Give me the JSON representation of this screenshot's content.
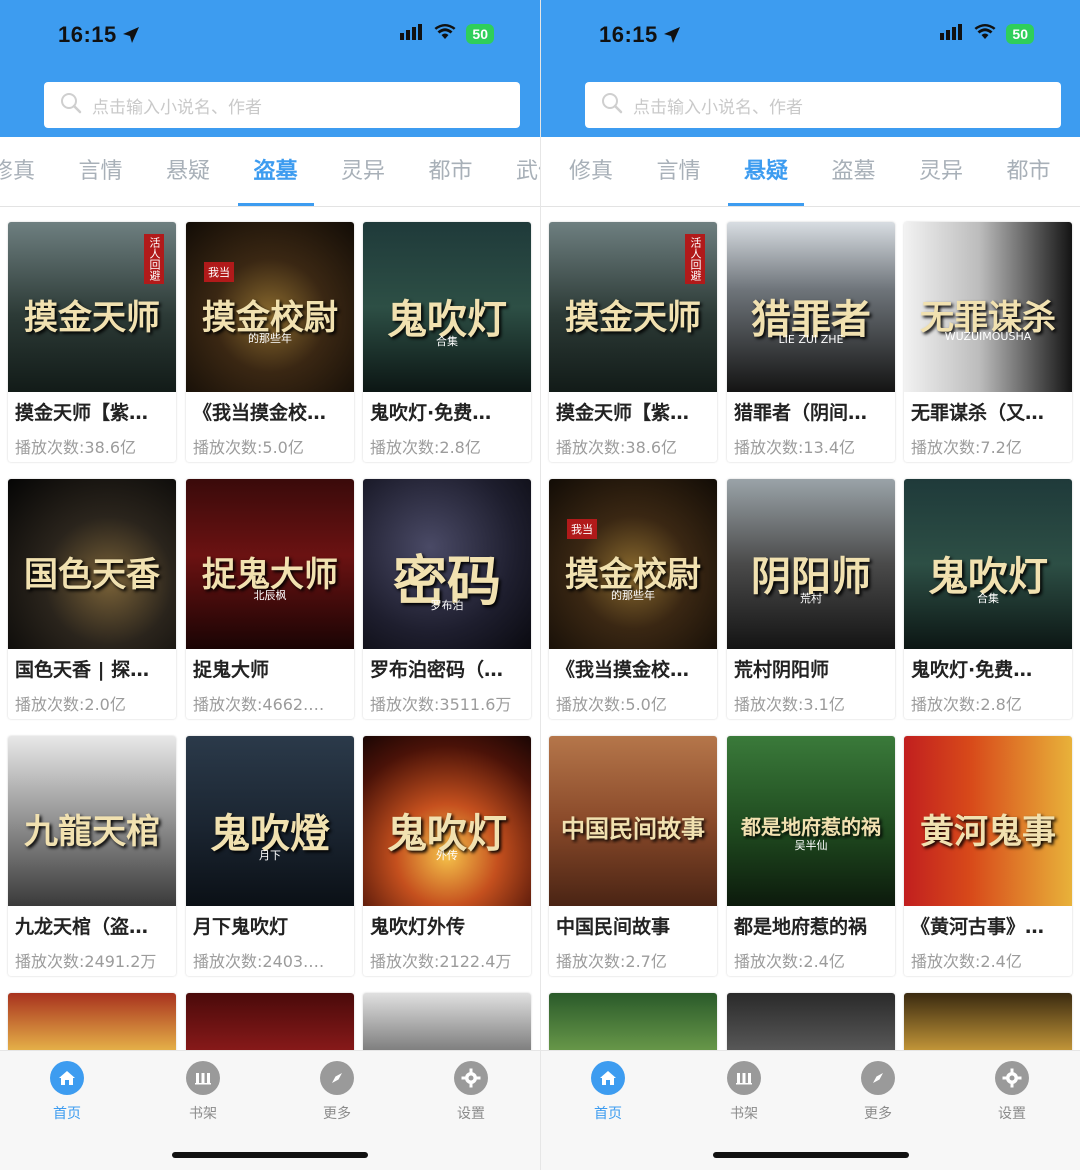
{
  "status": {
    "time": "16:15",
    "battery": "50"
  },
  "search": {
    "placeholder": "点击输入小说名、作者"
  },
  "left": {
    "tabs": [
      "修真",
      "言情",
      "悬疑",
      "盗墓",
      "灵异",
      "都市",
      "武侠"
    ],
    "active_tab": "盗墓",
    "books": [
      {
        "title": "摸金天师【紫…",
        "plays": "播放次数:38.6亿",
        "cover_text": "摸金天师",
        "cover_sub": "",
        "stamp": "活人回避",
        "bg": "linear-gradient(180deg,#6e7f80 0%,#2c3a36 55%,#121b18 100%)"
      },
      {
        "title": "《我当摸金校…",
        "plays": "播放次数:5.0亿",
        "cover_text": "摸金校尉",
        "cover_sub": "的那些年",
        "stamp": "我当",
        "bg": "radial-gradient(circle at 50% 55%,#8a6a2e 0%,#3a2713 45%,#120c06 100%)"
      },
      {
        "title": "鬼吹灯·免费…",
        "plays": "播放次数:2.8亿",
        "cover_text": "鬼吹灯",
        "cover_sub": "合集",
        "stamp": "",
        "bg": "linear-gradient(180deg,#1f3a3a 0%,#2d4f45 50%,#0c1614 100%)"
      },
      {
        "title": "国色天香 | 探…",
        "plays": "播放次数:2.0亿",
        "cover_text": "国色天香",
        "cover_sub": "",
        "stamp": "",
        "bg": "radial-gradient(circle at 60% 60%,#7a6238 0%,#2a241c 45%,#050505 100%)"
      },
      {
        "title": "捉鬼大师",
        "plays": "播放次数:4662.…",
        "cover_text": "捉鬼大师",
        "cover_sub": "北辰枫",
        "stamp": "",
        "bg": "linear-gradient(180deg,#3a0a0a 0%,#6b1212 45%,#1a0404 100%)"
      },
      {
        "title": "罗布泊密码（…",
        "plays": "播放次数:3511.6万",
        "cover_text": "密码",
        "cover_sub": "罗布泊",
        "stamp": "",
        "bg": "radial-gradient(circle at 40% 40%,#4a4a66 0%,#1e1e2e 60%,#0a0a10 100%)"
      },
      {
        "title": "九龙天棺（盗…",
        "plays": "播放次数:2491.2万",
        "cover_text": "九龍天棺",
        "cover_sub": "",
        "stamp": "",
        "bg": "linear-gradient(180deg,#e8e8e8 0%,#9a9a9a 45%,#3a3a3a 100%)"
      },
      {
        "title": "月下鬼吹灯",
        "plays": "播放次数:2403.…",
        "cover_text": "鬼吹燈",
        "cover_sub": "月下",
        "stamp": "",
        "bg": "linear-gradient(180deg,#2b3a4a 0%,#1a2430 55%,#0b1016 100%)"
      },
      {
        "title": "鬼吹灯外传",
        "plays": "播放次数:2122.4万",
        "cover_text": "鬼吹灯",
        "cover_sub": "外传",
        "stamp": "",
        "bg": "radial-gradient(circle at 50% 70%,#f5c24a 0%,#c5501e 35%,#4a1208 75%,#1a0604 100%)"
      }
    ]
  },
  "right": {
    "tabs": [
      "修真",
      "言情",
      "悬疑",
      "盗墓",
      "灵异",
      "都市"
    ],
    "active_tab": "悬疑",
    "books": [
      {
        "title": "摸金天师【紫…",
        "plays": "播放次数:38.6亿",
        "cover_text": "摸金天师",
        "cover_sub": "",
        "stamp": "活人回避",
        "bg": "linear-gradient(180deg,#6e7f80 0%,#2c3a36 55%,#121b18 100%)"
      },
      {
        "title": "猎罪者（阴间…",
        "plays": "播放次数:13.4亿",
        "cover_text": "猎罪者",
        "cover_sub": "LIE ZUI ZHE",
        "stamp": "",
        "bg": "linear-gradient(180deg,#d8dde2 0%,#6e747a 40%,#141414 100%)"
      },
      {
        "title": "无罪谋杀（又…",
        "plays": "播放次数:7.2亿",
        "cover_text": "无罪谋杀",
        "cover_sub": "WUZUIMOUSHA",
        "stamp": "",
        "bg": "linear-gradient(90deg,#f2f2f2 0%,#bcbcbc 45%,#141414 100%)"
      },
      {
        "title": "《我当摸金校…",
        "plays": "播放次数:5.0亿",
        "cover_text": "摸金校尉",
        "cover_sub": "的那些年",
        "stamp": "我当",
        "bg": "radial-gradient(circle at 50% 55%,#8a6a2e 0%,#3a2713 45%,#120c06 100%)"
      },
      {
        "title": "荒村阴阳师",
        "plays": "播放次数:3.1亿",
        "cover_text": "阴阳师",
        "cover_sub": "荒村",
        "stamp": "",
        "bg": "linear-gradient(180deg,#9aa3a8 0%,#4a4a4a 50%,#141414 100%)"
      },
      {
        "title": "鬼吹灯·免费…",
        "plays": "播放次数:2.8亿",
        "cover_text": "鬼吹灯",
        "cover_sub": "合集",
        "stamp": "",
        "bg": "linear-gradient(180deg,#1f3a3a 0%,#2d4f45 50%,#0c1614 100%)"
      },
      {
        "title": "中国民间故事",
        "plays": "播放次数:2.7亿",
        "cover_text": "中国民间故事",
        "cover_sub": "",
        "stamp": "",
        "bg": "linear-gradient(180deg,#b5764a 0%,#8a4a2a 50%,#4a2414 100%)"
      },
      {
        "title": "都是地府惹的祸",
        "plays": "播放次数:2.4亿",
        "cover_text": "都是地府惹的祸",
        "cover_sub": "吴半仙",
        "stamp": "",
        "bg": "linear-gradient(180deg,#3a7a3a 0%,#1f4a1f 55%,#0c1a0c 100%)"
      },
      {
        "title": "《黄河古事》…",
        "plays": "播放次数:2.4亿",
        "cover_text": "黄河鬼事",
        "cover_sub": "",
        "stamp": "",
        "bg": "linear-gradient(90deg,#c11f1f 0%,#d84a1a 40%,#e8b23a 100%)"
      }
    ]
  },
  "partial_covers": {
    "left": [
      "linear-gradient(180deg,#a8321e 0%,#e8b64a 100%)",
      "linear-gradient(180deg,#4a0a0a 0%,#8a1a1a 100%)",
      "linear-gradient(180deg,#e0e0e0 0%,#7a7a7a 100%)"
    ],
    "right": [
      "linear-gradient(180deg,#2a5a2a 0%,#6a9a4a 100%)",
      "linear-gradient(180deg,#2a2a2a 0%,#5a5a5a 100%)",
      "linear-gradient(180deg,#3a2a10 0%,#c89a3a 100%)"
    ]
  },
  "nav": [
    {
      "label": "首页",
      "icon": "home-icon"
    },
    {
      "label": "书架",
      "icon": "bookshelf-icon"
    },
    {
      "label": "更多",
      "icon": "compass-icon"
    },
    {
      "label": "设置",
      "icon": "gear-icon"
    }
  ],
  "colors": {
    "accent": "#3d9cf0",
    "header": "#3d9cf0",
    "battery": "#2fcf5a"
  }
}
